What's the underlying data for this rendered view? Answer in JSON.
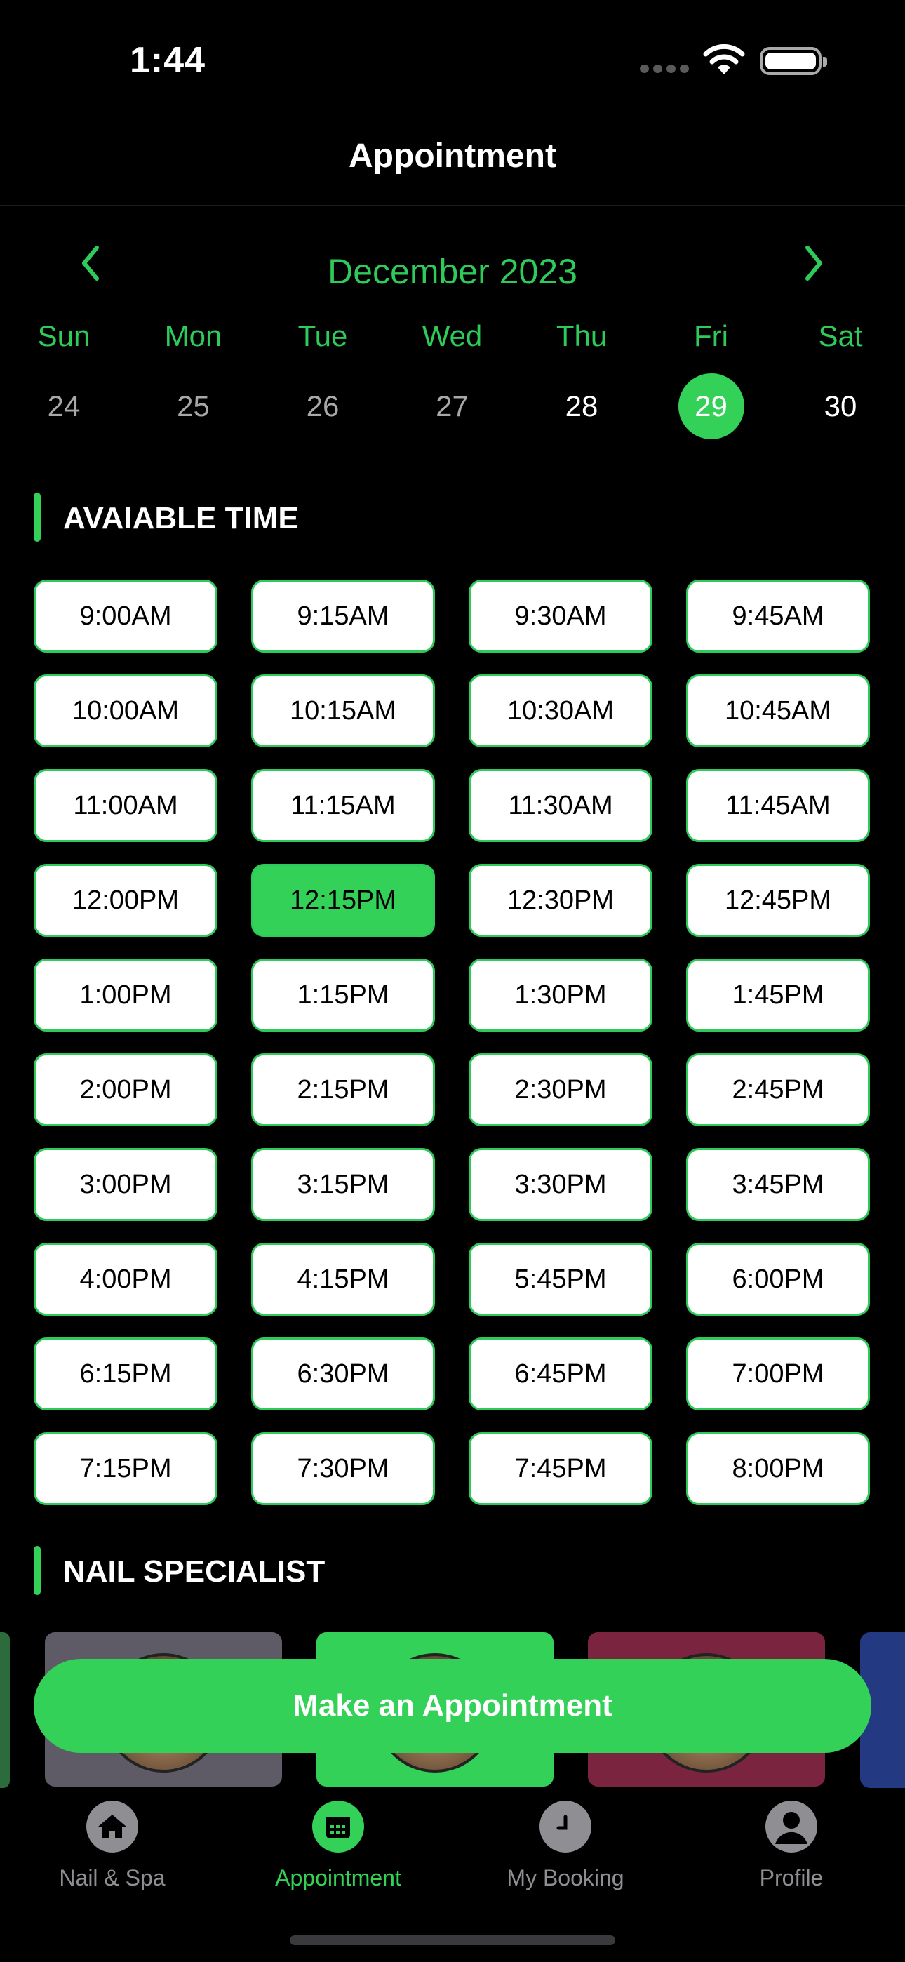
{
  "status_bar": {
    "time": "1:44"
  },
  "header": {
    "title": "Appointment"
  },
  "calendar": {
    "month_label": "December 2023",
    "days": [
      {
        "dow": "Sun",
        "num": "24"
      },
      {
        "dow": "Mon",
        "num": "25"
      },
      {
        "dow": "Tue",
        "num": "26"
      },
      {
        "dow": "Wed",
        "num": "27"
      },
      {
        "dow": "Thu",
        "num": "28"
      },
      {
        "dow": "Fri",
        "num": "29"
      },
      {
        "dow": "Sat",
        "num": "30"
      }
    ],
    "selected_day": "29"
  },
  "sections": {
    "available_time": "AVAIABLE TIME",
    "nail_specialist": "NAIL SPECIALIST"
  },
  "time_slots": [
    "9:00AM",
    "9:15AM",
    "9:30AM",
    "9:45AM",
    "10:00AM",
    "10:15AM",
    "10:30AM",
    "10:45AM",
    "11:00AM",
    "11:15AM",
    "11:30AM",
    "11:45AM",
    "12:00PM",
    "12:15PM",
    "12:30PM",
    "12:45PM",
    "1:00PM",
    "1:15PM",
    "1:30PM",
    "1:45PM",
    "2:00PM",
    "2:15PM",
    "2:30PM",
    "2:45PM",
    "3:00PM",
    "3:15PM",
    "3:30PM",
    "3:45PM",
    "4:00PM",
    "4:15PM",
    "5:45PM",
    "6:00PM",
    "6:15PM",
    "6:30PM",
    "6:45PM",
    "7:00PM",
    "7:15PM",
    "7:30PM",
    "7:45PM",
    "8:00PM"
  ],
  "selected_time": "12:15PM",
  "specialist_card_colors": [
    "#5f5b66",
    "#34d158",
    "#7a2440"
  ],
  "cta": {
    "label": "Make an Appointment"
  },
  "tabs": [
    {
      "label": "Nail & Spa",
      "icon": "home-icon"
    },
    {
      "label": "Appointment",
      "icon": "calendar-icon"
    },
    {
      "label": "My Booking",
      "icon": "clock-icon"
    },
    {
      "label": "Profile",
      "icon": "person-icon"
    }
  ],
  "active_tab": "Appointment",
  "colors": {
    "accent": "#34d158",
    "background": "#000000"
  }
}
